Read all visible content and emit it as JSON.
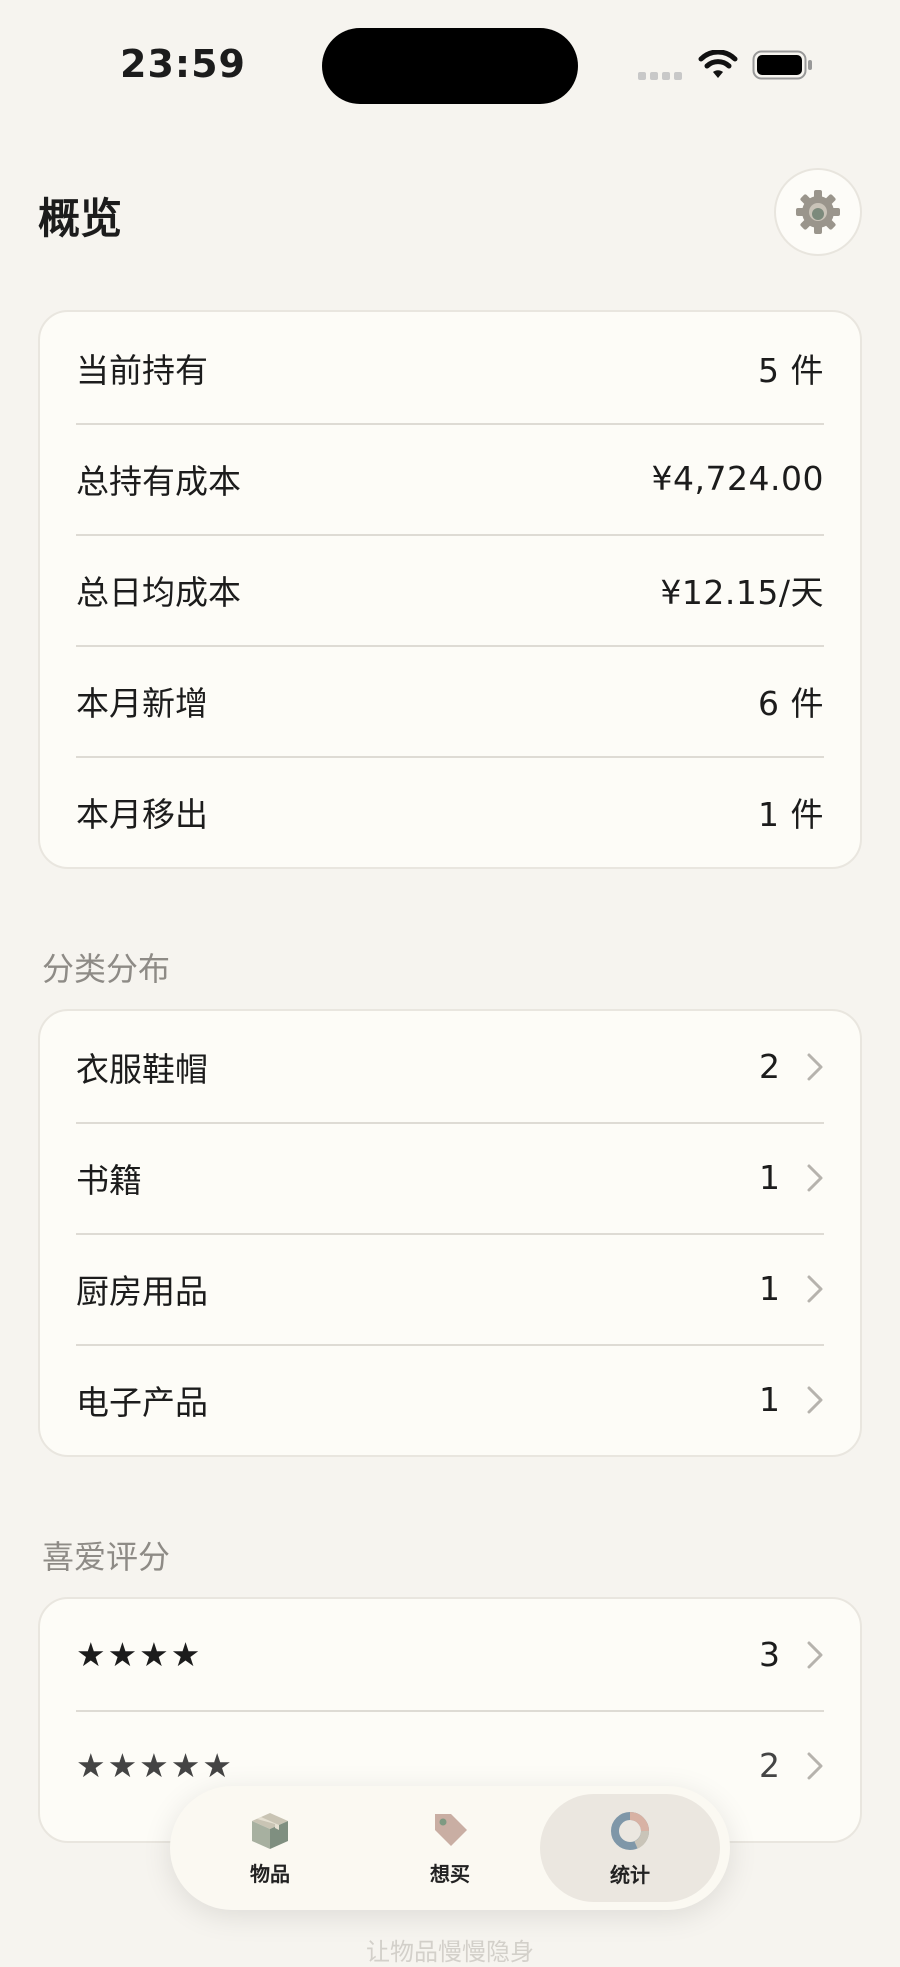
{
  "status": {
    "time": "23:59"
  },
  "header": {
    "title": "概览"
  },
  "overview": {
    "rows": [
      {
        "label": "当前持有",
        "value": "5 件"
      },
      {
        "label": "总持有成本",
        "value": "¥4,724.00"
      },
      {
        "label": "总日均成本",
        "value": "¥12.15/天"
      },
      {
        "label": "本月新增",
        "value": "6 件"
      },
      {
        "label": "本月移出",
        "value": "1 件"
      }
    ]
  },
  "categories": {
    "title": "分类分布",
    "rows": [
      {
        "label": "衣服鞋帽",
        "count": "2"
      },
      {
        "label": "书籍",
        "count": "1"
      },
      {
        "label": "厨房用品",
        "count": "1"
      },
      {
        "label": "电子产品",
        "count": "1"
      }
    ]
  },
  "ratings": {
    "title": "喜爱评分",
    "rows": [
      {
        "stars": "★★★★",
        "count": "3"
      },
      {
        "stars": "★★★★★",
        "count": "2"
      }
    ]
  },
  "tabbar": {
    "tabs": [
      {
        "label": "物品",
        "icon": "box-icon"
      },
      {
        "label": "想买",
        "icon": "tag-icon"
      },
      {
        "label": "统计",
        "icon": "donut-chart-icon"
      }
    ],
    "active": "统计"
  },
  "footer": {
    "hint": "让物品慢慢隐身"
  }
}
